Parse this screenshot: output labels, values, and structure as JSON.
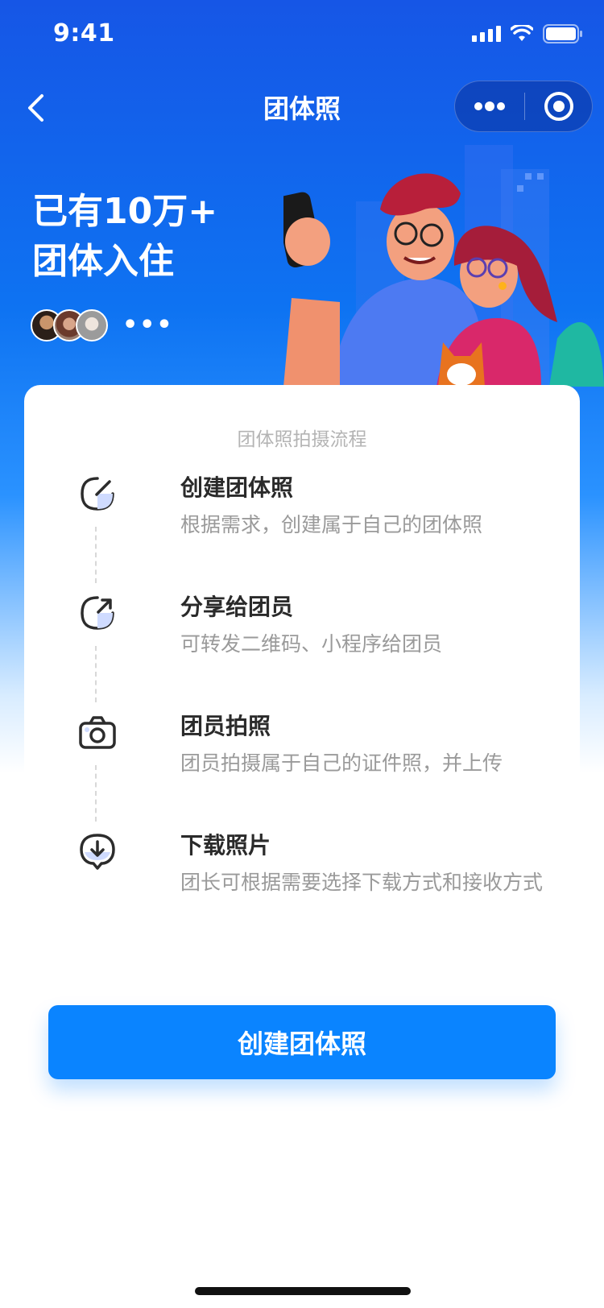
{
  "status_bar": {
    "time": "9:41"
  },
  "nav": {
    "title": "团体照"
  },
  "hero": {
    "line1": "已有10万+",
    "line2": "团体入住",
    "more": "•••"
  },
  "card": {
    "title": "团体照拍摄流程",
    "steps": [
      {
        "name": "创建团体照",
        "desc": "根据需求，创建属于自己的团体照",
        "icon": "edit-icon"
      },
      {
        "name": "分享给团员",
        "desc": "可转发二维码、小程序给团员",
        "icon": "share-icon"
      },
      {
        "name": "团员拍照",
        "desc": "团员拍摄属于自己的证件照，并上传",
        "icon": "camera-icon"
      },
      {
        "name": "下载照片",
        "desc": "团长可根据需要选择下载方式和接收方式",
        "icon": "download-icon"
      }
    ]
  },
  "button": {
    "label": "创建团体照"
  },
  "colors": {
    "accent": "#0a84ff",
    "header": "#1656e6"
  }
}
